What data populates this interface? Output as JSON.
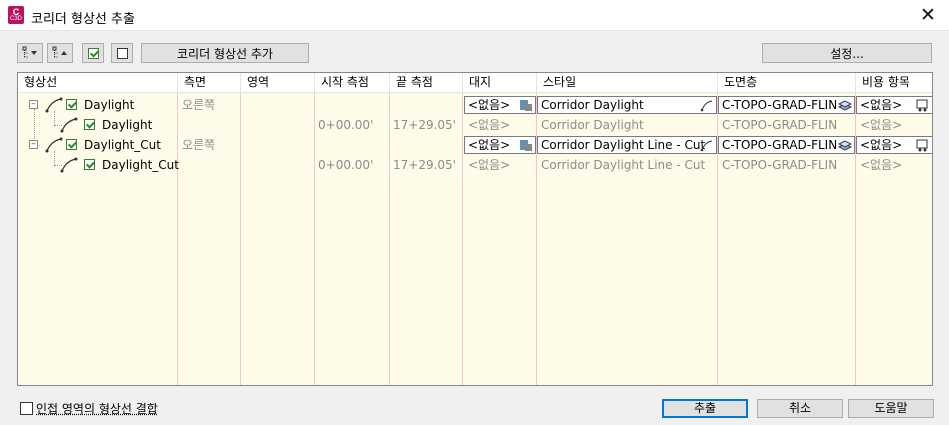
{
  "window": {
    "title": "코리더 형상선 추출",
    "app_icon": {
      "letter": "C",
      "sub": "C3D"
    },
    "close_symbol": "✕"
  },
  "toolbar": {
    "expand_icon": "tree-expand-icon",
    "collapse_icon": "tree-collapse-icon",
    "add_button": "코리더 형상선 추가",
    "settings_button": "설정..."
  },
  "grid": {
    "columns": [
      "형상선",
      "측면",
      "영역",
      "시작 측점",
      "끝 측점",
      "대지",
      "스타일",
      "도면층",
      "비용 항목"
    ],
    "rows": [
      {
        "name": "Daylight",
        "side": "오른쪽",
        "region": "",
        "start": "",
        "end": "",
        "site": "<없음>",
        "style": "Corridor Daylight",
        "layer": "C-TOPO-GRAD-FLIN",
        "pay": "<없음>",
        "level": 0,
        "editable": true
      },
      {
        "name": "Daylight",
        "side": "",
        "region": "",
        "start": "0+00.00'",
        "end": "17+29.05'",
        "site": "<없음>",
        "style": "Corridor Daylight",
        "layer": "C-TOPO-GRAD-FLIN",
        "pay": "<없음>",
        "level": 1,
        "editable": false
      },
      {
        "name": "Daylight_Cut",
        "side": "오른쪽",
        "region": "",
        "start": "",
        "end": "",
        "site": "<없음>",
        "style": "Corridor Daylight Line - Cut",
        "layer": "C-TOPO-GRAD-FLIN",
        "pay": "<없음>",
        "level": 0,
        "editable": true
      },
      {
        "name": "Daylight_Cut",
        "side": "",
        "region": "",
        "start": "0+00.00'",
        "end": "17+29.05'",
        "site": "<없음>",
        "style": "Corridor Daylight Line - Cut",
        "layer": "C-TOPO-GRAD-FLIN",
        "pay": "<없음>",
        "level": 1,
        "editable": false
      }
    ]
  },
  "footer": {
    "merge_checkbox_label": "인접 영역의 형상선 결합",
    "extract_button": "추출",
    "cancel_button": "취소",
    "help_button": "도움말"
  },
  "colors": {
    "grid_background": "#fefce8",
    "separator_pink": "#f2c7c7",
    "check_green": "#2c8a2c",
    "default_button_border": "#0078d7",
    "disabled_text": "#8c8c8c"
  }
}
